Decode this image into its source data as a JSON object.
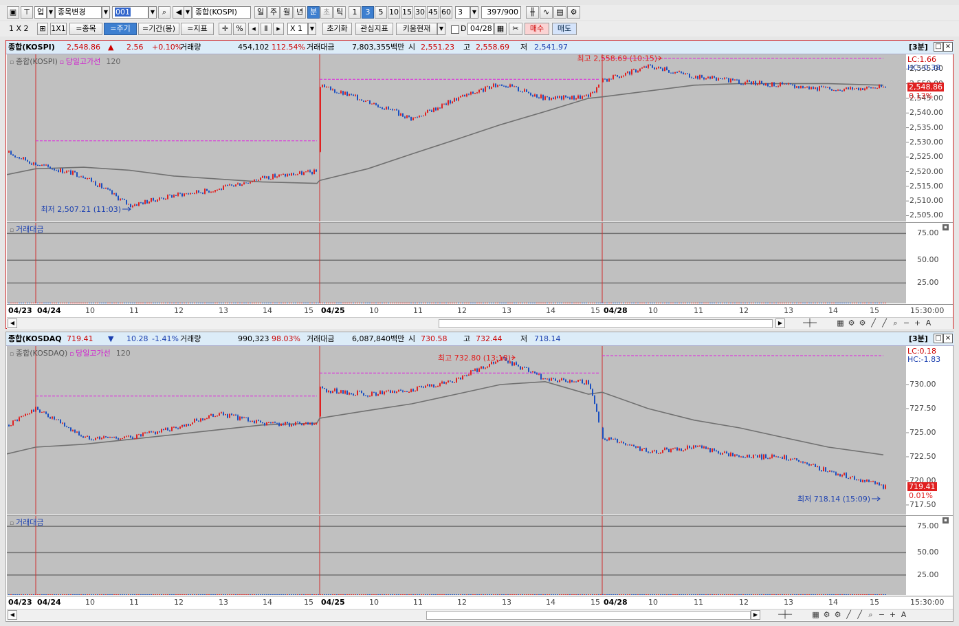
{
  "toolbar1": {
    "dropdown_up": "업",
    "stock_change": "종목변경",
    "code_value": "001",
    "index_name": "종합(KOSPI)",
    "periods": [
      "일",
      "주",
      "월",
      "년",
      "분",
      "초",
      "틱"
    ],
    "selected_period": "분",
    "intervals": [
      "1",
      "3",
      "5",
      "10",
      "15",
      "30",
      "45",
      "60"
    ],
    "selected_interval": "3",
    "interval_value": "3",
    "count": "397/900"
  },
  "toolbar2": {
    "layout": "1 X 2",
    "btn_1x1": "1X1",
    "btn_stock": "=종목",
    "btn_cycle": "=주기",
    "btn_period": "=기간(봉)",
    "btn_indicator": "=지표",
    "btn_percent": "%",
    "zoom": "X 1",
    "btn_reset": "초기화",
    "btn_interest": "관심지표",
    "btn_kiwoom": "키움현재",
    "date_value": "04/28",
    "btn_buy": "매수",
    "btn_sell": "매도"
  },
  "panels": [
    {
      "header": {
        "name": "종합(KOSPI)",
        "price": "2,548.86",
        "arrow": "▲",
        "change": "2.56",
        "change_pct": "+0.10%",
        "vol_label": "거래량",
        "volume": "454,102",
        "vol_ratio": "112.54%",
        "amt_label": "거래대금",
        "amount": "7,803,355백만",
        "open_label": "시",
        "open": "2,551.23",
        "high_label": "고",
        "high": "2,558.69",
        "low_label": "저",
        "low": "2,541.97",
        "timeframe": "[3분]"
      },
      "legend": {
        "series": "종합(KOSPI)",
        "overlay": "당일고가선",
        "ma": "120"
      },
      "annot_high": "최고 2,558.69 (10:15)",
      "annot_low": "최저 2,507.21 (11:03)",
      "lc": "LC:1.66",
      "hc": "HC:-0.38",
      "last_price": "2,548.86",
      "last_pct": "0.13%",
      "y_ticks": [
        "2,555.00",
        "2,550.00",
        "2,545.00",
        "2,540.00",
        "2,535.00",
        "2,530.00",
        "2,525.00",
        "2,520.00",
        "2,515.00",
        "2,510.00",
        "2,505.00"
      ],
      "sub_title": "거래대금",
      "sub_ticks": [
        "75.00",
        "50.00",
        "25.00"
      ],
      "x_labels": [
        "04/23",
        "04/24",
        "10",
        "11",
        "12",
        "13",
        "14",
        "15",
        "04/25",
        "10",
        "11",
        "12",
        "13",
        "14",
        "15",
        "04/28",
        "10",
        "11",
        "12",
        "13",
        "14",
        "15"
      ],
      "time_label": "15:30:00"
    },
    {
      "header": {
        "name": "종합(KOSDAQ",
        "price": "719.41",
        "arrow": "▼",
        "change": "10.28",
        "change_pct": "-1.41%",
        "vol_label": "거래량",
        "volume": "990,323",
        "vol_ratio": "98.03%",
        "amt_label": "거래대금",
        "amount": "6,087,840백만",
        "open_label": "시",
        "open": "730.58",
        "high_label": "고",
        "high": "732.44",
        "low_label": "저",
        "low": "718.14",
        "timeframe": "[3분]"
      },
      "legend": {
        "series": "종합(KOSDAQ)",
        "overlay": "당일고가선",
        "ma": "120"
      },
      "annot_high": "최고 732.80 (13:18)",
      "annot_low": "최저 718.14 (15:09)",
      "lc": "LC:0.18",
      "hc": "HC:-1.83",
      "last_price": "719.41",
      "last_pct": "0.01%",
      "y_ticks": [
        "730.00",
        "727.50",
        "725.00",
        "722.50",
        "720.00",
        "717.50"
      ],
      "sub_title": "거래대금",
      "sub_ticks": [
        "75.00",
        "50.00",
        "25.00"
      ],
      "x_labels": [
        "04/23",
        "04/24",
        "10",
        "11",
        "12",
        "13",
        "14",
        "15",
        "04/25",
        "10",
        "11",
        "12",
        "13",
        "14",
        "15",
        "04/28",
        "10",
        "11",
        "12",
        "13",
        "14",
        "15"
      ],
      "time_label": "15:30:00"
    }
  ],
  "chart_data": [
    {
      "type": "candlestick-line",
      "title": "종합(KOSPI)",
      "ylim": [
        2503,
        2560
      ],
      "x": [
        "04/23 15:30",
        "04/24 09:00",
        "04/24 10:00",
        "04/24 11:00",
        "04/24 12:00",
        "04/24 13:00",
        "04/24 14:00",
        "04/24 15:30",
        "04/25 09:00",
        "04/25 10:00",
        "04/25 11:00",
        "04/25 12:00",
        "04/25 13:00",
        "04/25 14:00",
        "04/25 15:30",
        "04/28 09:00",
        "04/28 10:00",
        "04/28 11:00",
        "04/28 12:00",
        "04/28 13:00",
        "04/28 14:00",
        "04/28 15:30"
      ],
      "close": [
        2526.5,
        2522.5,
        2518.5,
        2508.5,
        2512.0,
        2514.0,
        2518.0,
        2520.0,
        2549.0,
        2544.0,
        2538.0,
        2545.0,
        2550.0,
        2545.0,
        2545.5,
        2551.0,
        2556.0,
        2552.5,
        2550.5,
        2549.5,
        2548.0,
        2548.86
      ],
      "ma120": [
        2519.0,
        2521.0,
        2521.5,
        2520.5,
        2518.5,
        2517.5,
        2516.5,
        2516.0,
        2517.0,
        2521.0,
        2526.0,
        2531.0,
        2536.0,
        2540.5,
        2545.0,
        2545.5,
        2547.5,
        2549.5,
        2550.0,
        2550.0,
        2550.0,
        2549.5
      ],
      "day_high_line": [
        {
          "day": "04/24",
          "value": 2530.5
        },
        {
          "day": "04/25",
          "value": 2551.5
        },
        {
          "day": "04/28",
          "value": 2558.7
        }
      ],
      "high": {
        "value": 2558.69,
        "time": "10:15"
      },
      "low": {
        "value": 2507.21,
        "time": "11:03"
      }
    },
    {
      "type": "candlestick-line",
      "title": "종합(KOSDAQ",
      "ylim": [
        716.5,
        734
      ],
      "x": [
        "04/23 15:30",
        "04/24 09:00",
        "04/24 10:00",
        "04/24 11:00",
        "04/24 12:00",
        "04/24 13:00",
        "04/24 14:00",
        "04/24 15:30",
        "04/25 09:00",
        "04/25 10:00",
        "04/25 11:00",
        "04/25 12:00",
        "04/25 13:00",
        "04/25 14:00",
        "04/25 15:30",
        "04/28 09:00",
        "04/28 10:00",
        "04/28 11:00",
        "04/28 12:00",
        "04/28 13:00",
        "04/28 14:00",
        "04/28 15:30"
      ],
      "close": [
        725.8,
        727.5,
        724.5,
        724.5,
        725.5,
        727.0,
        726.0,
        725.8,
        729.5,
        729.0,
        729.5,
        730.5,
        732.8,
        730.5,
        730.2,
        724.5,
        723.0,
        723.5,
        722.5,
        722.5,
        721.0,
        719.41
      ],
      "ma120": [
        722.8,
        723.5,
        723.8,
        724.3,
        724.8,
        725.3,
        725.8,
        726.0,
        726.5,
        727.3,
        728.0,
        729.0,
        730.0,
        730.3,
        729.0,
        729.2,
        727.5,
        726.3,
        725.5,
        724.5,
        723.5,
        722.7
      ],
      "day_high_line": [
        {
          "day": "04/24",
          "value": 728.8
        },
        {
          "day": "04/25",
          "value": 731.2
        },
        {
          "day": "04/28",
          "value": 733.0
        }
      ],
      "high": {
        "value": 732.8,
        "time": "13:18"
      },
      "low": {
        "value": 718.14,
        "time": "15:09"
      }
    }
  ],
  "colors": {
    "up": "#e02020",
    "down": "#1a4fc0",
    "ma": "#7a7a7a",
    "day_high": "#e020e0",
    "plot_bg": "#c0c0c0",
    "frame_red": "#d02020"
  }
}
